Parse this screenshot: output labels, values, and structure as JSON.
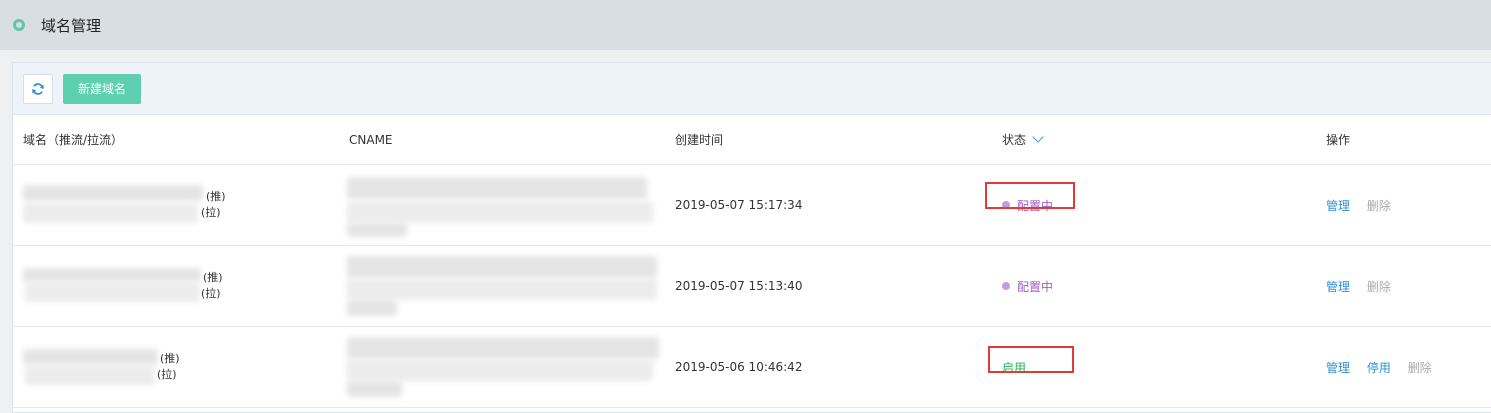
{
  "header": {
    "title": "域名管理"
  },
  "toolbar": {
    "refresh_icon": "refresh-icon",
    "new_button": "新建域名"
  },
  "table": {
    "columns": [
      "域名（推流/拉流）",
      "CNAME",
      "创建时间",
      "状态",
      "操作"
    ],
    "push_suffix": "(推)",
    "pull_suffix": "(拉)",
    "rows": [
      {
        "created": "2019-05-07 15:17:34",
        "status": "配置中",
        "actions": [
          "管理",
          "删除"
        ]
      },
      {
        "created": "2019-05-07 15:13:40",
        "status": "配置中",
        "actions": [
          "管理",
          "删除"
        ]
      },
      {
        "created": "2019-05-06 10:46:42",
        "status": "启用",
        "actions": [
          "管理",
          "停用",
          "删除"
        ]
      }
    ]
  },
  "colors": {
    "accent": "#5ecfb1",
    "link": "#2f8fd8",
    "config_status": "#a05fc0",
    "enabled_status": "#2db055",
    "highlight_box": "#e03a3a"
  }
}
